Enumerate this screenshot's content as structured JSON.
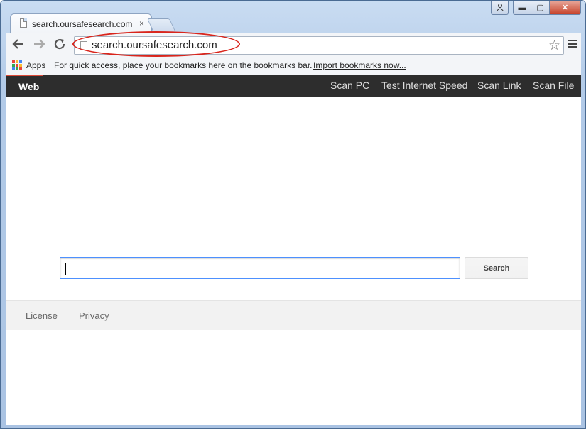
{
  "browser": {
    "tab_title": "search.oursafesearch.com",
    "tab_close": "×",
    "address": "search.oursafesearch.com",
    "window_buttons": {
      "minimize": "▬",
      "maximize": "▢",
      "close": "✕"
    }
  },
  "bookmarks_bar": {
    "apps_label": "Apps",
    "hint": "For quick access, place your bookmarks here on the bookmarks bar.",
    "import_link": "Import bookmarks now..."
  },
  "nav": {
    "active": "Web",
    "links": [
      "Scan PC",
      "Test Internet Speed",
      "Scan Link",
      "Scan File"
    ]
  },
  "search": {
    "input_value": "",
    "button_label": "Search"
  },
  "footer": {
    "links": [
      "License",
      "Privacy"
    ]
  },
  "colors": {
    "navbar": "#2d2d2d",
    "highlight_ring": "#d9251c",
    "input_focus": "#4d90fe",
    "active_tab_accent": "#dd4b39"
  },
  "icons": [
    "page-icon",
    "back-arrow-icon",
    "forward-arrow-icon",
    "reload-icon",
    "star-icon",
    "menu-icon",
    "apps-grid-icon",
    "user-icon"
  ]
}
